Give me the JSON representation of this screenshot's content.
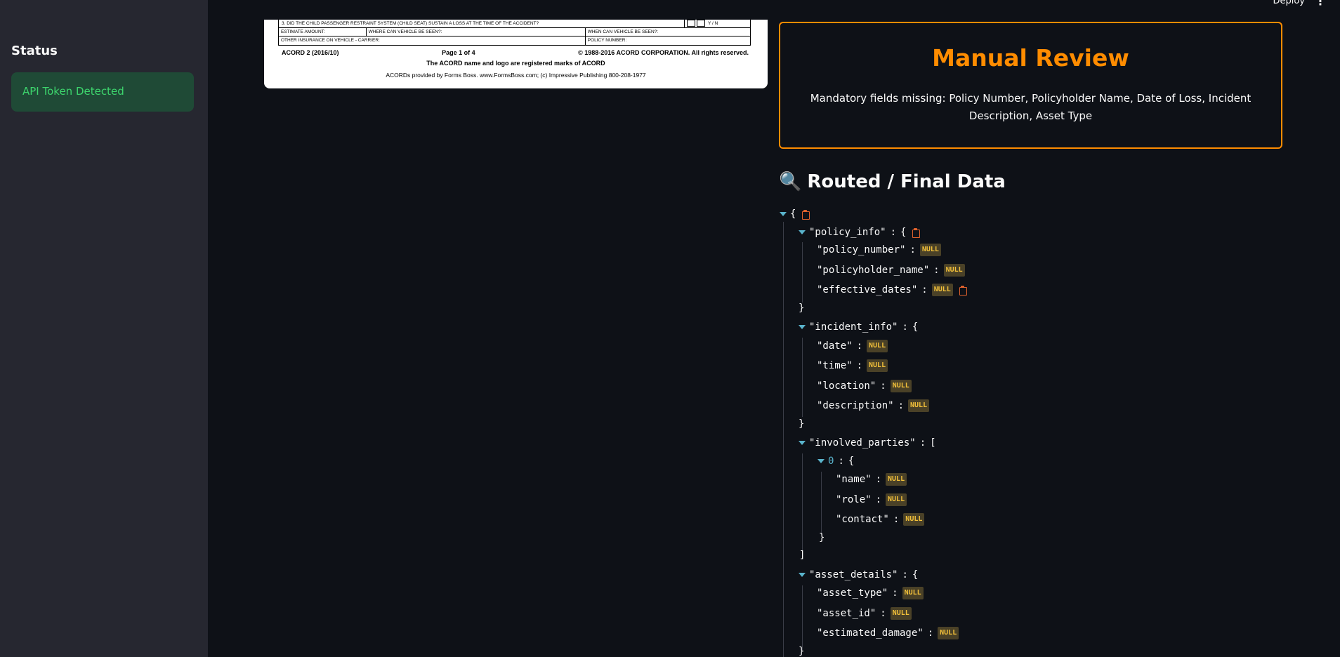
{
  "topbar": {
    "deploy_label": "Deploy",
    "menu_icon": "kebab-menu-icon"
  },
  "sidebar": {
    "title": "Status",
    "status_message": "API Token Detected",
    "status_color": "#3dd56d"
  },
  "document": {
    "row1": "3.   DID THE CHILD PASSENGER RESTRAINT SYSTEM (CHILD SEAT) SUSTAIN A LOSS AT THE TIME OF THE ACCIDENT?",
    "row1_yn": "Y / N",
    "row2_c1": "ESTIMATE AMOUNT:",
    "row2_c2": "WHERE CAN VEHICLE BE SEEN?:",
    "row2_c3": "WHEN CAN VEHICLE BE SEEN?:",
    "row3_c1": "OTHER INSURANCE ON VEHICLE - CARRIER:",
    "row3_c2": "POLICY NUMBER:",
    "form_id": "ACORD 2 (2016/10)",
    "page": "Page 1 of 4",
    "copyright": "© 1988-2016 ACORD CORPORATION.  All rights reserved.",
    "trademark": "The ACORD name and logo are registered marks of ACORD",
    "provider": "ACORDs provided by Forms Boss. www.FormsBoss.com; (c) Impressive Publishing 800-208-1977"
  },
  "review": {
    "title": "Manual Review",
    "message": "Mandatory fields missing: Policy Number, Policyholder Name, Date of Loss, Incident Description, Asset Type",
    "accent_color": "#ff8c00"
  },
  "routed": {
    "title": "Routed / Final Data",
    "icon": "magnifying-glass-icon"
  },
  "json_view": {
    "open_brace": "{",
    "close_brace": "}",
    "open_bracket": "[",
    "close_bracket": "]",
    "colon": ":",
    "null_label": "NULL",
    "policy_info_key": "\"policy_info\"",
    "policy_number_key": "\"policy_number\"",
    "policyholder_name_key": "\"policyholder_name\"",
    "effective_dates_key": "\"effective_dates\"",
    "incident_info_key": "\"incident_info\"",
    "date_key": "\"date\"",
    "time_key": "\"time\"",
    "location_key": "\"location\"",
    "description_key": "\"description\"",
    "involved_parties_key": "\"involved_parties\"",
    "index_0": "0",
    "name_key": "\"name\"",
    "role_key": "\"role\"",
    "contact_key": "\"contact\"",
    "asset_details_key": "\"asset_details\"",
    "asset_type_key": "\"asset_type\"",
    "asset_id_key": "\"asset_id\"",
    "estimated_damage_key": "\"estimated_damage\""
  }
}
